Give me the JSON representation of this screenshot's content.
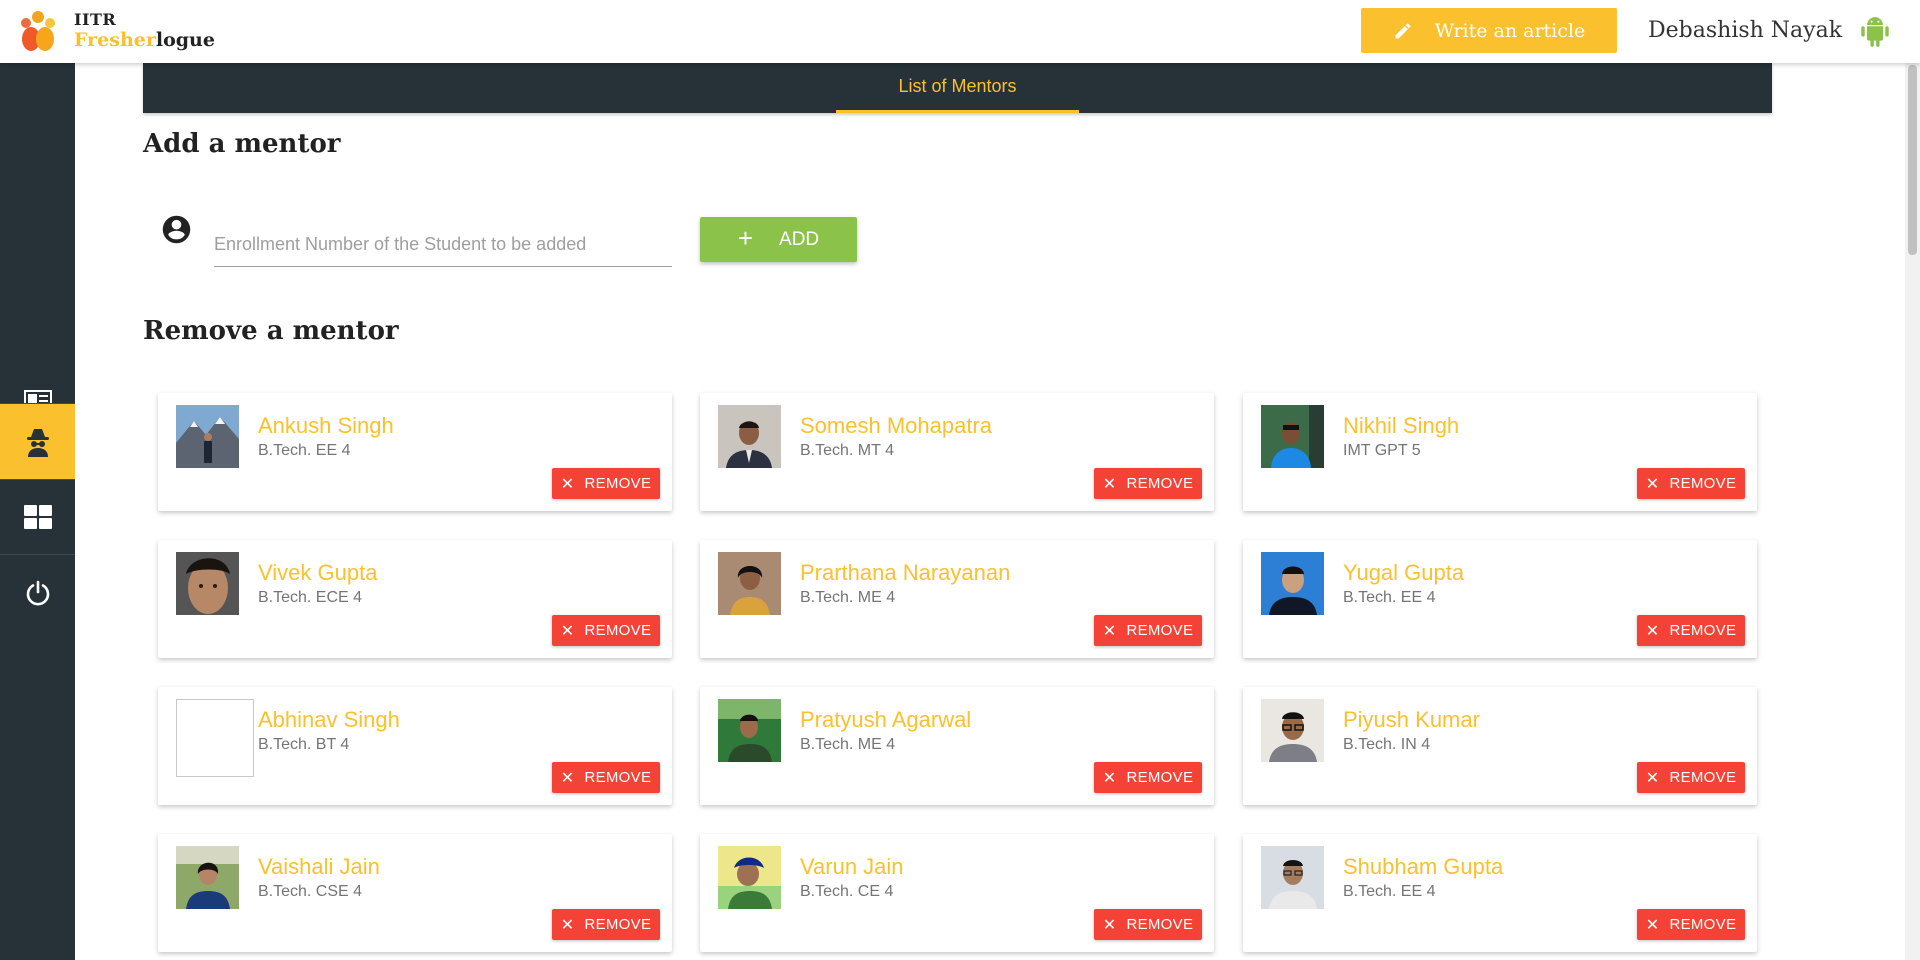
{
  "brand": {
    "line1": "IITR",
    "fresher": "Fresher",
    "logue": "logue"
  },
  "header": {
    "write_label": "Write an article",
    "username": "Debashish Nayak"
  },
  "sidebar": {
    "items": [
      "newspaper-icon",
      "spy-icon",
      "dashboard-icon",
      "power-icon"
    ],
    "active_index": 1
  },
  "tabs": [
    {
      "label": "List of Mentors",
      "active": true
    }
  ],
  "add_section": {
    "title": "Add a mentor",
    "placeholder": "Enrollment Number of the Student to be added",
    "value": "",
    "button_label": "ADD"
  },
  "remove_section": {
    "title": "Remove a mentor",
    "button_label": "REMOVE"
  },
  "mentors": [
    {
      "name": "Ankush Singh",
      "program": "B.Tech. EE 4",
      "photo": "mountain"
    },
    {
      "name": "Somesh Mohapatra",
      "program": "B.Tech. MT 4",
      "photo": "suit"
    },
    {
      "name": "Nikhil Singh",
      "program": "IMT GPT 5",
      "photo": "blue"
    },
    {
      "name": "Vivek Gupta",
      "program": "B.Tech. ECE 4",
      "photo": "face"
    },
    {
      "name": "Prarthana Narayanan",
      "program": "B.Tech. ME 4",
      "photo": "girl"
    },
    {
      "name": "Yugal Gupta",
      "program": "B.Tech. EE 4",
      "photo": "bluebg"
    },
    {
      "name": "Abhinav Singh",
      "program": "B.Tech. BT 4",
      "photo": "broken"
    },
    {
      "name": "Pratyush Agarwal",
      "program": "B.Tech. ME 4",
      "photo": "green"
    },
    {
      "name": "Piyush Kumar",
      "program": "B.Tech. IN 4",
      "photo": "glasses"
    },
    {
      "name": "Vaishali Jain",
      "program": "B.Tech. CSE 4",
      "photo": "outdoor"
    },
    {
      "name": "Varun Jain",
      "program": "B.Tech. CE 4",
      "photo": "yellow"
    },
    {
      "name": "Shubham Gupta",
      "program": "B.Tech. EE 4",
      "photo": "formal"
    }
  ],
  "colors": {
    "accent": "#fbc02d",
    "sidebar": "#263238",
    "add": "#8bc34a",
    "remove": "#f44336"
  }
}
